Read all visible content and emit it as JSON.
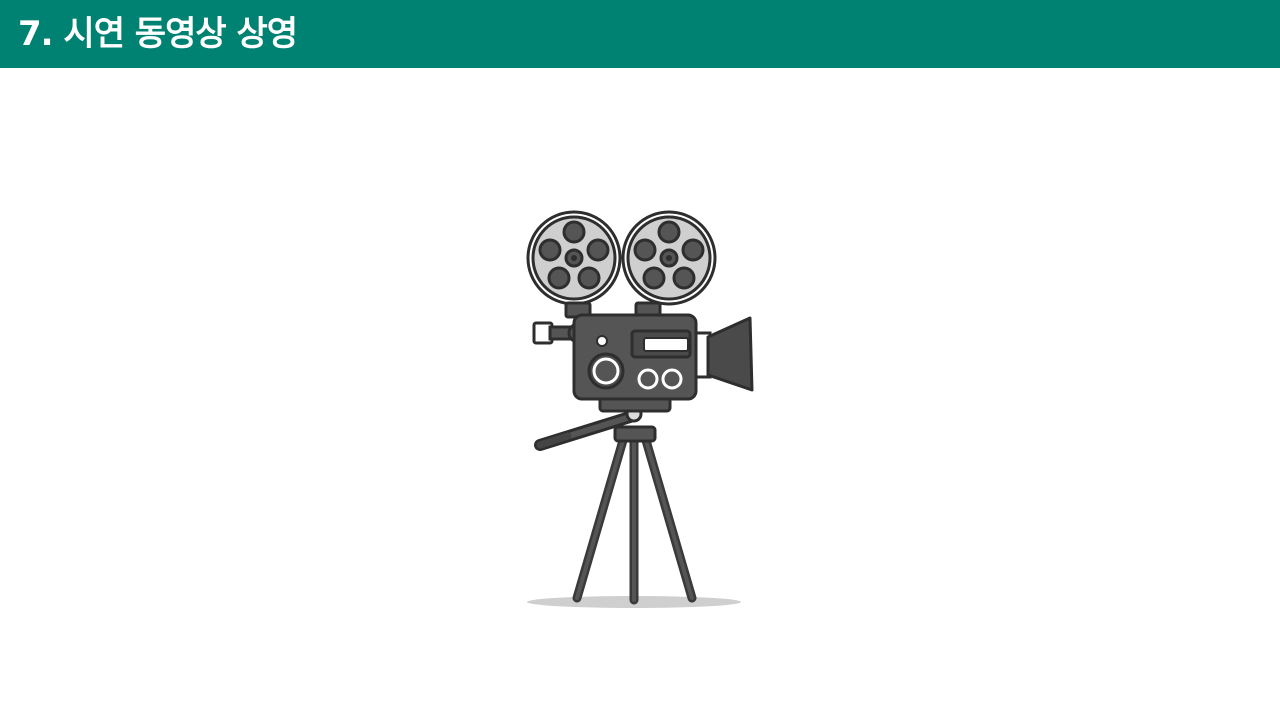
{
  "slide": {
    "title": "7. 시연 동영상 상영",
    "header_color": "#008272",
    "illustration": "movie-camera-on-tripod-icon"
  }
}
